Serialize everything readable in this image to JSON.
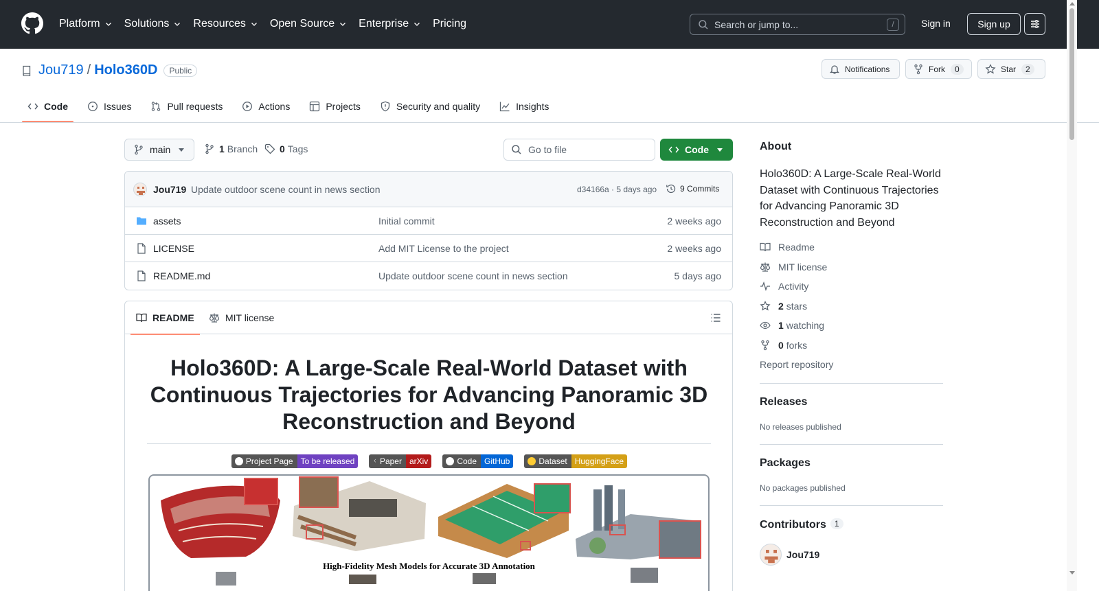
{
  "topbar": {
    "nav": [
      {
        "label": "Platform",
        "dropdown": true
      },
      {
        "label": "Solutions",
        "dropdown": true
      },
      {
        "label": "Resources",
        "dropdown": true
      },
      {
        "label": "Open Source",
        "dropdown": true
      },
      {
        "label": "Enterprise",
        "dropdown": true
      },
      {
        "label": "Pricing",
        "dropdown": false
      }
    ],
    "search_placeholder": "Search or jump to...",
    "search_shortcut": "/",
    "signin": "Sign in",
    "signup": "Sign up"
  },
  "repo": {
    "owner": "Jou719",
    "separator": "/",
    "name": "Holo360D",
    "visibility": "Public",
    "notifications_label": "Notifications",
    "fork_label": "Fork",
    "fork_count": "0",
    "star_label": "Star",
    "star_count": "2"
  },
  "tabs": [
    {
      "label": "Code",
      "icon": "code-icon",
      "active": true
    },
    {
      "label": "Issues",
      "icon": "issue-icon",
      "active": false
    },
    {
      "label": "Pull requests",
      "icon": "pull-request-icon",
      "active": false
    },
    {
      "label": "Actions",
      "icon": "play-icon",
      "active": false
    },
    {
      "label": "Projects",
      "icon": "table-icon",
      "active": false
    },
    {
      "label": "Security and quality",
      "icon": "shield-icon",
      "active": false
    },
    {
      "label": "Insights",
      "icon": "graph-icon",
      "active": false
    }
  ],
  "toolbar": {
    "branch": "main",
    "branch_count": "1",
    "branch_label": "Branch",
    "tag_count": "0",
    "tag_label": "Tags",
    "goto_placeholder": "Go to file",
    "code_button": "Code"
  },
  "latest_commit": {
    "author": "Jou719",
    "message": "Update outdoor scene count in news section",
    "hash_time": "d34166a · 5 days ago",
    "commits_label": "9 Commits"
  },
  "files": [
    {
      "name": "assets",
      "type": "folder",
      "message": "Initial commit",
      "time": "2 weeks ago"
    },
    {
      "name": "LICENSE",
      "type": "file",
      "message": "Add MIT License to the project",
      "time": "2 weeks ago"
    },
    {
      "name": "README.md",
      "type": "file",
      "message": "Update outdoor scene count in news section",
      "time": "5 days ago"
    }
  ],
  "readme": {
    "tab_readme": "README",
    "tab_license": "MIT license",
    "title": "Holo360D: A Large-Scale Real-World Dataset with Continuous Trajectories for Advancing Panoramic 3D Reconstruction and Beyond",
    "badges": [
      {
        "left": "Project Page",
        "right": "To be released",
        "color": "#6f42c1"
      },
      {
        "left": "Paper",
        "right": "arXiv",
        "color": "#b31b1b"
      },
      {
        "left": "Code",
        "right": "GitHub",
        "color": "#0366d6"
      },
      {
        "left": "Dataset",
        "right": "HuggingFace",
        "color": "#d4a017"
      }
    ],
    "teaser_caption": "High-Fidelity Mesh Models for Accurate 3D Annotation"
  },
  "sidebar": {
    "about_title": "About",
    "about_desc": "Holo360D: A Large-Scale Real-World Dataset with Continuous Trajectories for Advancing Panoramic 3D Reconstruction and Beyond",
    "links": [
      {
        "icon": "book-icon",
        "bold": "",
        "label": "Readme"
      },
      {
        "icon": "law-icon",
        "bold": "",
        "label": "MIT license"
      },
      {
        "icon": "pulse-icon",
        "bold": "",
        "label": "Activity"
      },
      {
        "icon": "star-icon",
        "bold": "2",
        "label": "stars"
      },
      {
        "icon": "eye-icon",
        "bold": "1",
        "label": "watching"
      },
      {
        "icon": "fork-icon",
        "bold": "0",
        "label": "forks"
      }
    ],
    "report": "Report repository",
    "releases_title": "Releases",
    "releases_empty": "No releases published",
    "packages_title": "Packages",
    "packages_empty": "No packages published",
    "contributors_title": "Contributors",
    "contributors_count": "1",
    "contributor_name": "Jou719"
  }
}
